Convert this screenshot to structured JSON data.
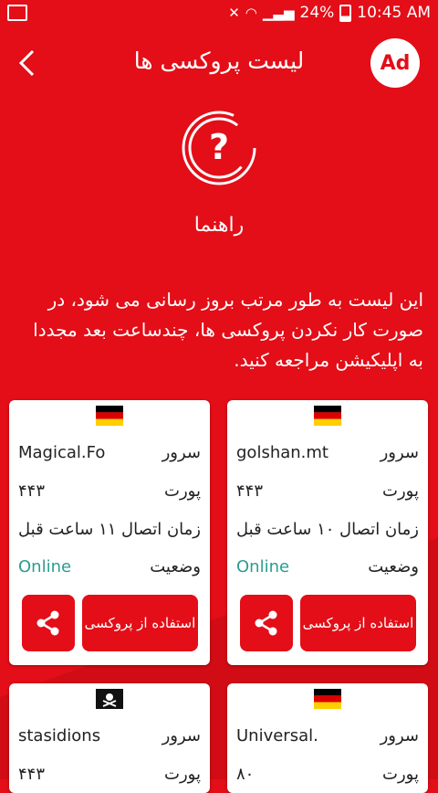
{
  "status_bar": {
    "icons": [
      "image-icon",
      "mute-icon",
      "wifi-icon",
      "signal-icon"
    ],
    "battery": "24%",
    "time": "10:45 AM"
  },
  "app_bar": {
    "title": "لیست پروکسی ها",
    "ad_label": "Ad"
  },
  "help": {
    "label": "راهنما"
  },
  "info_text": "این لیست به طور مرتب بروز رسانی می شود، در صورت کار نکردن پروکسی ها، چندساعت بعد مجددا به اپلیکیشن مراجعه کنید.",
  "labels": {
    "server": "سرور",
    "port": "پورت",
    "connect_time": "زمان اتصال",
    "status": "وضعیت",
    "use_button": "استفاده از پروکسی"
  },
  "proxies": [
    {
      "flag": "germany",
      "server": "golshan.mt",
      "port": "۴۴۳",
      "connect_time": "۱۰ ساعت قبل",
      "status": "Online"
    },
    {
      "flag": "germany",
      "server": "Magical.Fo",
      "port": "۴۴۳",
      "connect_time": "۱۱ ساعت قبل",
      "status": "Online"
    },
    {
      "flag": "germany",
      "server": "Universal.",
      "port": "۸۰"
    },
    {
      "flag": "pirate",
      "server": "stasidions",
      "port": "۴۴۳"
    }
  ],
  "colors": {
    "primary": "#e30e18",
    "online": "#2a9d8f"
  }
}
